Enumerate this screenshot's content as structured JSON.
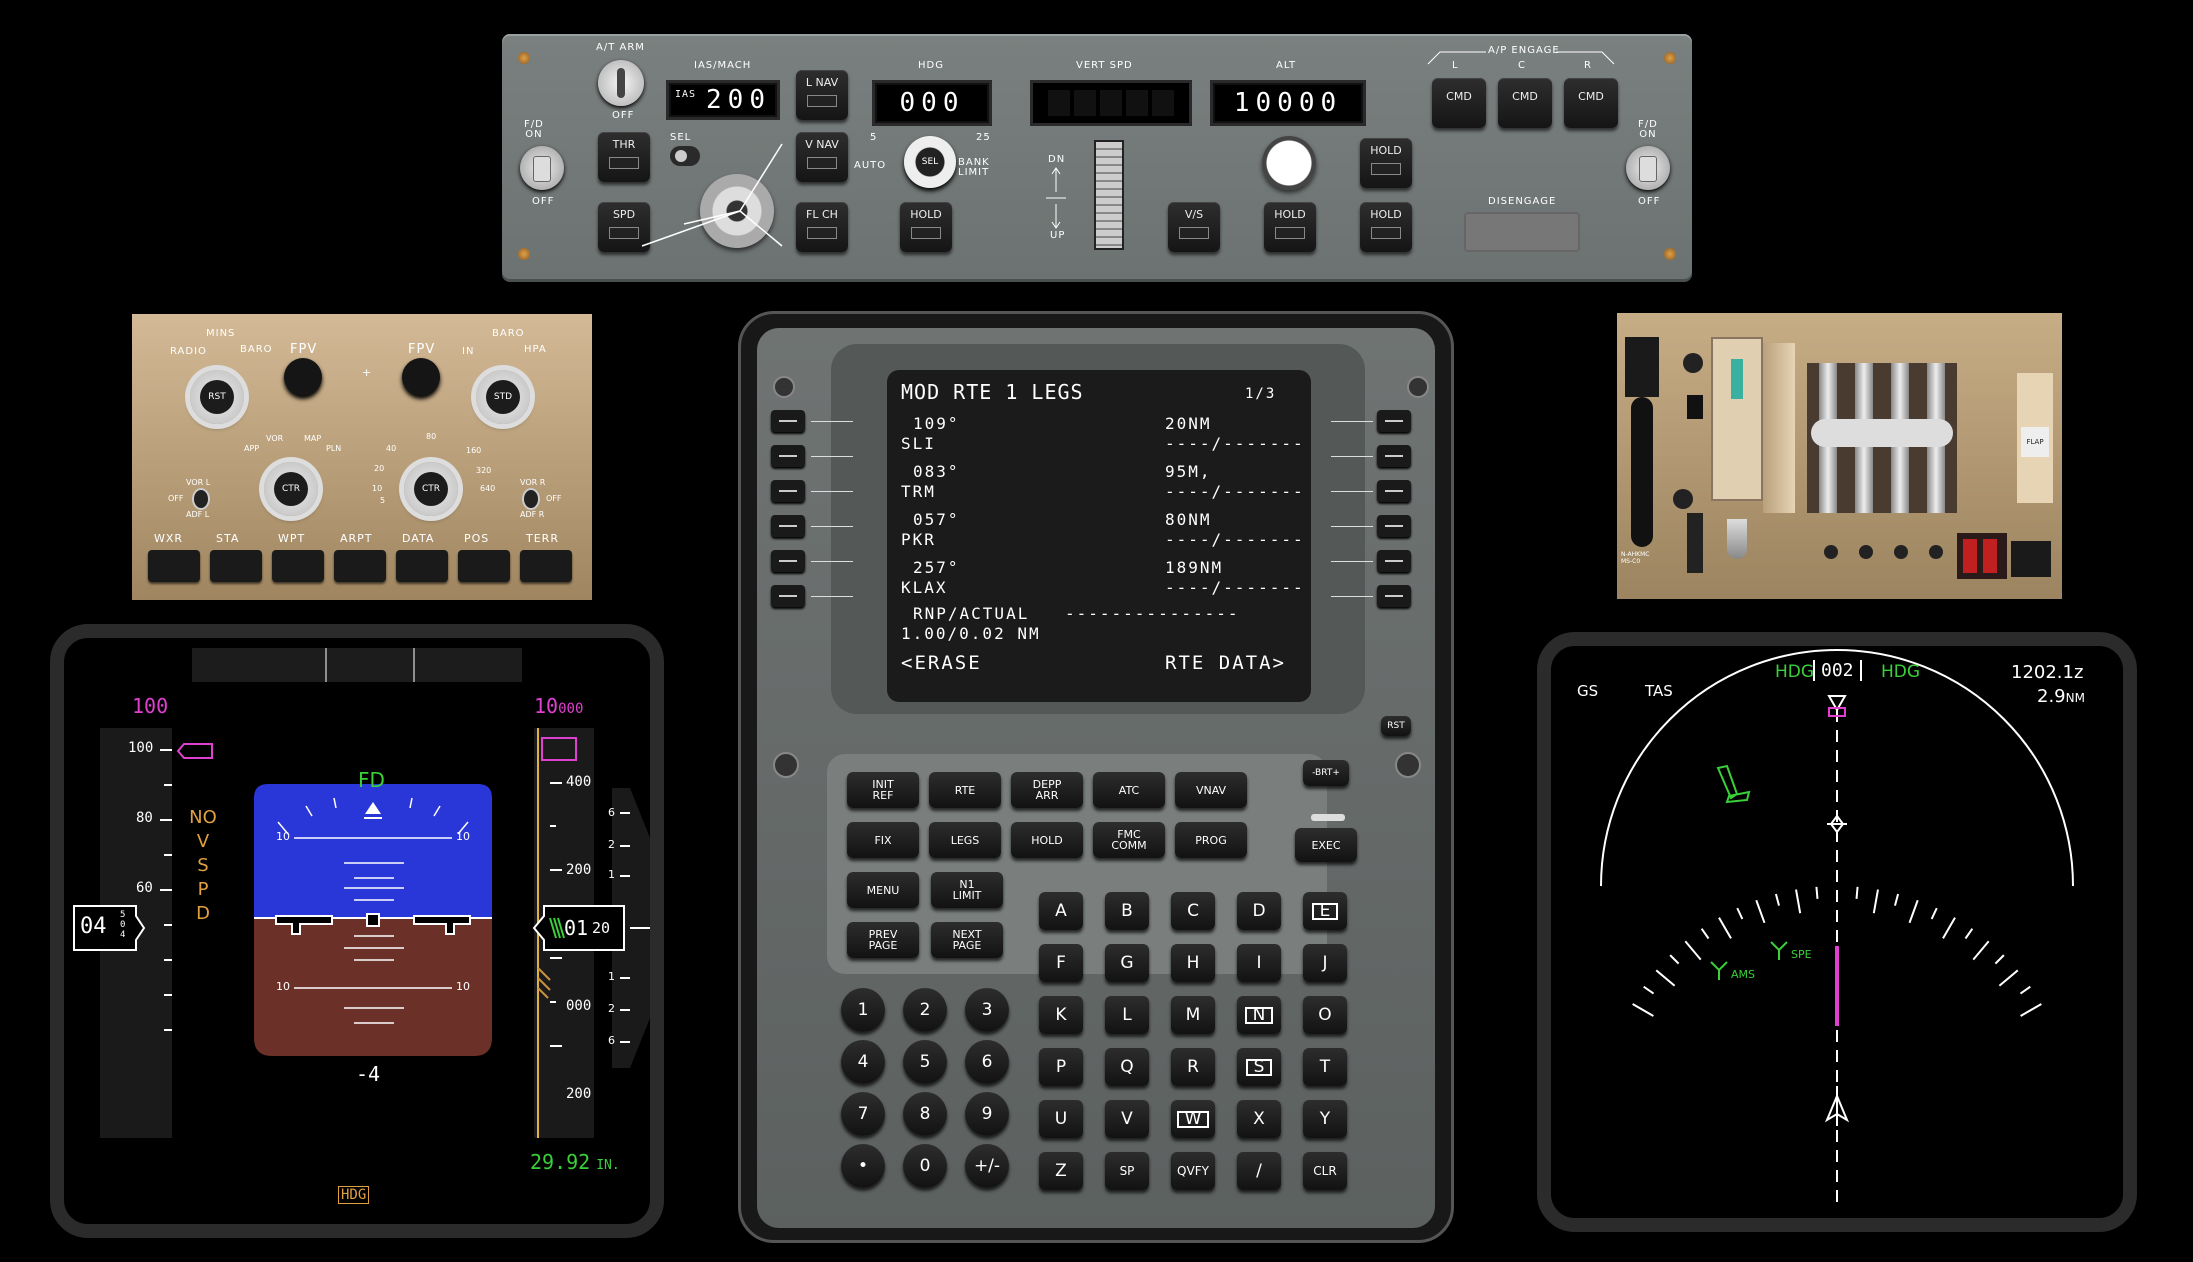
{
  "mcp": {
    "fd_left": {
      "on": "F/D\nON",
      "off": "OFF"
    },
    "fd_right": {
      "on": "F/D\nON",
      "off": "OFF"
    },
    "at_arm": "A/T ARM",
    "at_off": "OFF",
    "thr": "THR",
    "spd": "SPD",
    "ias_mach_label": "IAS/MACH",
    "ias_tag": "IAS",
    "ias_value": "200",
    "sel": "SEL",
    "lnav": "L NAV",
    "vnav": "V NAV",
    "flch": "FL CH",
    "hdg_label": "HDG",
    "hdg_value": "000",
    "hdg_hold": "HOLD",
    "bank": {
      "five": "5",
      "twentyfive": "25",
      "auto": "AUTO",
      "sel": "SEL",
      "limit": "BANK\nLIMIT"
    },
    "vs_label": "VERT SPD",
    "vs_dn": "DN",
    "vs_up": "UP",
    "vs_btn": "V/S",
    "alt_label": "ALT",
    "alt_value": "10000",
    "alt_hold": "HOLD",
    "hold_top": "HOLD",
    "hold_bottom": "HOLD",
    "ap_engage": "A/P ENGAGE",
    "ap_l": "L",
    "ap_c": "C",
    "ap_r": "R",
    "cmd": "CMD",
    "disengage": "DISENGAGE"
  },
  "efis": {
    "mins": "MINS",
    "radio": "RADIO",
    "baro": "BARO",
    "rst": "RST",
    "fpv": "FPV",
    "fpv2": "FPV",
    "baro_r": "BARO",
    "in": "IN",
    "hpa": "HPA",
    "std": "STD",
    "app": "APP",
    "vor": "VOR",
    "map": "MAP",
    "pln": "PLN",
    "ctr": "CTR",
    "r5": "5",
    "r10": "10",
    "r20": "20",
    "r40": "40",
    "r80": "80",
    "r160": "160",
    "r320": "320",
    "r640": "640",
    "vor_l": "VOR L",
    "off_l": "OFF",
    "adf_l": "ADF L",
    "vor_r": "VOR R",
    "off_r": "OFF",
    "adf_r": "ADF R",
    "buttons": [
      "WXR",
      "STA",
      "WPT",
      "ARPT",
      "DATA",
      "POS",
      "TERR"
    ]
  },
  "pfd": {
    "speed_target": "100",
    "alt_target_big": "10",
    "alt_target_small": "000",
    "spd_ticks": [
      "100",
      "80",
      "60"
    ],
    "no_vspd": [
      "NO",
      "V",
      "S",
      "P",
      "D"
    ],
    "fd": "FD",
    "pitch10": "10",
    "speed_readout": "04",
    "speed_digits": "5 0 4",
    "alt_readout": "01",
    "alt_digits": "20",
    "alt_ticks": [
      "400",
      "200",
      "000",
      "200"
    ],
    "vs_scale": [
      "6",
      "2",
      "1",
      "1",
      "2",
      "6"
    ],
    "vs_value": "-4",
    "baro": "29.92",
    "baro_unit": "IN.",
    "hdg": "HDG"
  },
  "cdu": {
    "title": "MOD RTE 1 LEGS",
    "page": "1/3",
    "legs": [
      {
        "crs": "109°",
        "dist": "20NM",
        "wpt": "SLI",
        "alt": "----/-------"
      },
      {
        "crs": "083°",
        "dist": "95M,",
        "wpt": "TRM",
        "alt": "----/-------"
      },
      {
        "crs": "057°",
        "dist": "80NM",
        "wpt": "PKR",
        "alt": "----/-------"
      },
      {
        "crs": "257°",
        "dist": "189NM",
        "wpt": "KLAX",
        "alt": "----/-------"
      }
    ],
    "rnp_label": "RNP/ACTUAL",
    "rnp_dash": "---------------",
    "rnp_value": "1.00/0.02 NM",
    "erase": "<ERASE",
    "rte_data": "RTE DATA>",
    "rst": "RST",
    "brt": "-BRT+",
    "exec": "EXEC",
    "func_keys": [
      [
        "INIT\nREF",
        "RTE",
        "DEPP\nARR",
        "ATC",
        "VNAV"
      ],
      [
        "FIX",
        "LEGS",
        "HOLD",
        "FMC\nCOMM",
        "PROG"
      ]
    ],
    "menu": "MENU",
    "n1": "N1\nLIMIT",
    "prev": "PREV\nPAGE",
    "next": "NEXT\nPAGE",
    "letters": [
      "A",
      "B",
      "C",
      "D",
      "E",
      "F",
      "G",
      "H",
      "I",
      "J",
      "K",
      "L",
      "M",
      "N",
      "O",
      "P",
      "Q",
      "R",
      "S",
      "T",
      "U",
      "V",
      "W",
      "X",
      "Y"
    ],
    "boxed": [
      "E",
      "N",
      "S",
      "W"
    ],
    "bottom": [
      "Z",
      "SP",
      "QVFY",
      "/",
      "CLR"
    ],
    "numbers": [
      "1",
      "2",
      "3",
      "4",
      "5",
      "6",
      "7",
      "8",
      "9",
      "•",
      "0",
      "+/-"
    ]
  },
  "throttle": {
    "reg": "N-AHKMC\nMS-C0",
    "flap": "FLAP"
  },
  "nd": {
    "gs": "GS",
    "tas": "TAS",
    "hdg_l": "HDG",
    "hdg_value": "002",
    "hdg_r": "HDG",
    "time": "1202.1z",
    "dist": "2.9",
    "dist_unit": "NM",
    "wpt1": "AMS",
    "wpt2": "SPE"
  }
}
